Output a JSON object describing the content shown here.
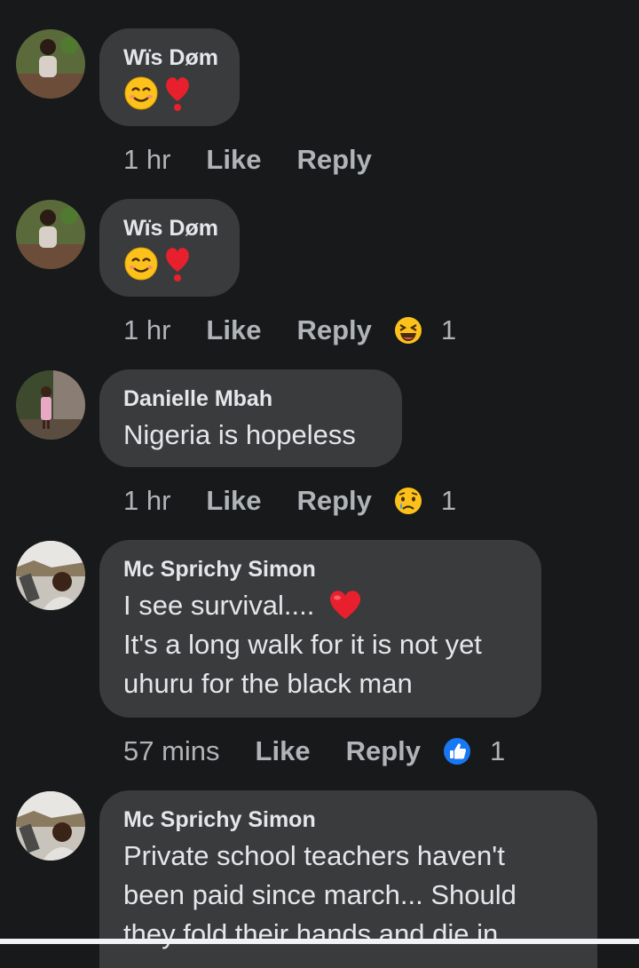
{
  "comments": [
    {
      "author": "Wïs Døm",
      "time": "1 hr",
      "like": "Like",
      "reply": "Reply"
    },
    {
      "author": "Wïs Døm",
      "time": "1 hr",
      "like": "Like",
      "reply": "Reply",
      "reaction_count": "1",
      "reaction_icon": "laughing-emoji-icon"
    },
    {
      "author": "Danielle Mbah",
      "text": "Nigeria is hopeless",
      "time": "1 hr",
      "like": "Like",
      "reply": "Reply",
      "reaction_count": "1",
      "reaction_icon": "sad-tear-emoji-icon"
    },
    {
      "author": "Mc Sprichy Simon",
      "text_line1": "I see survival....",
      "text_line2": "It's a long walk for it is not yet",
      "text_line3": "uhuru for the black man",
      "time": "57 mins",
      "like": "Like",
      "reply": "Reply",
      "reaction_count": "1",
      "reaction_icon": "thumbs-up-icon"
    },
    {
      "author": "Mc Sprichy Simon",
      "text_line1": "Private school teachers haven't",
      "text_line2": "been paid since march... Should",
      "text_line3": "they fold their hands and die in"
    }
  ],
  "colors": {
    "background": "#18191a",
    "bubble": "#3a3b3c",
    "text": "#e4e6eb",
    "meta": "#b0b3b8",
    "like_blue": "#1877f2"
  }
}
